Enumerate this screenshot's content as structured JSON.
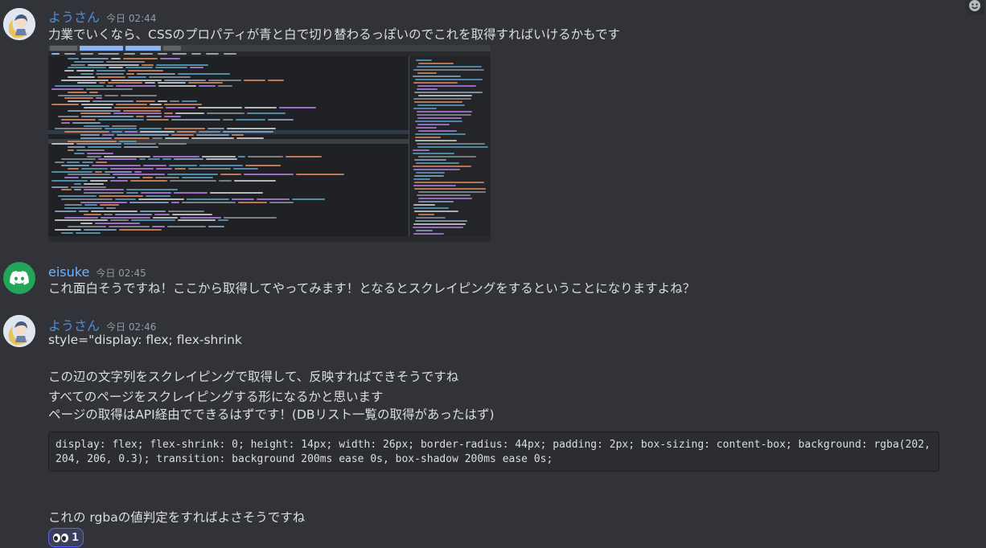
{
  "messages": [
    {
      "username": "ようさん",
      "timestamp": "今日 02:44",
      "lines": [
        "力業でいくなら、CSSのプロパティが青と白で切り替わるっぽいのでこれを取得すればいけるかもです"
      ]
    },
    {
      "username": "eisuke",
      "timestamp": "今日 02:45",
      "lines": [
        "これ面白そうですね！ここから取得してやってみます！となるとスクレイピングをするということになりますよね？"
      ]
    },
    {
      "username": "ようさん",
      "timestamp": "今日 02:46",
      "lines": [
        "style=\"display: flex; flex-shrink",
        "この辺の文字列をスクレイピングで取得して、反映すればできそうですね",
        "すべてのページをスクレイピングする形になるかと思います",
        "ページの取得はAPI経由でできるはずです！(DBリスト一覧の取得があったはず)"
      ],
      "code": "display: flex; flex-shrink: 0; height: 14px; width: 26px; border-radius: 44px; padding: 2px; box-sizing: content-box; background: rgba(202, 204, 206, 0.3); transition: background 200ms ease 0s, box-shadow 200ms ease 0s;",
      "after_code": "これの rgbaの値判定をすればよさそうですね",
      "reaction": {
        "emoji": "eyes",
        "count": "1"
      }
    }
  ],
  "colors": {
    "background": "#313338",
    "username_yousan": "#4a90e2",
    "username_eisuke": "#6fb3ff",
    "discord_green": "#23a559",
    "reaction_border": "#5865f2"
  },
  "icons": [
    "discord-logo-icon",
    "eyes-emoji-icon",
    "emoji-picker-icon"
  ]
}
